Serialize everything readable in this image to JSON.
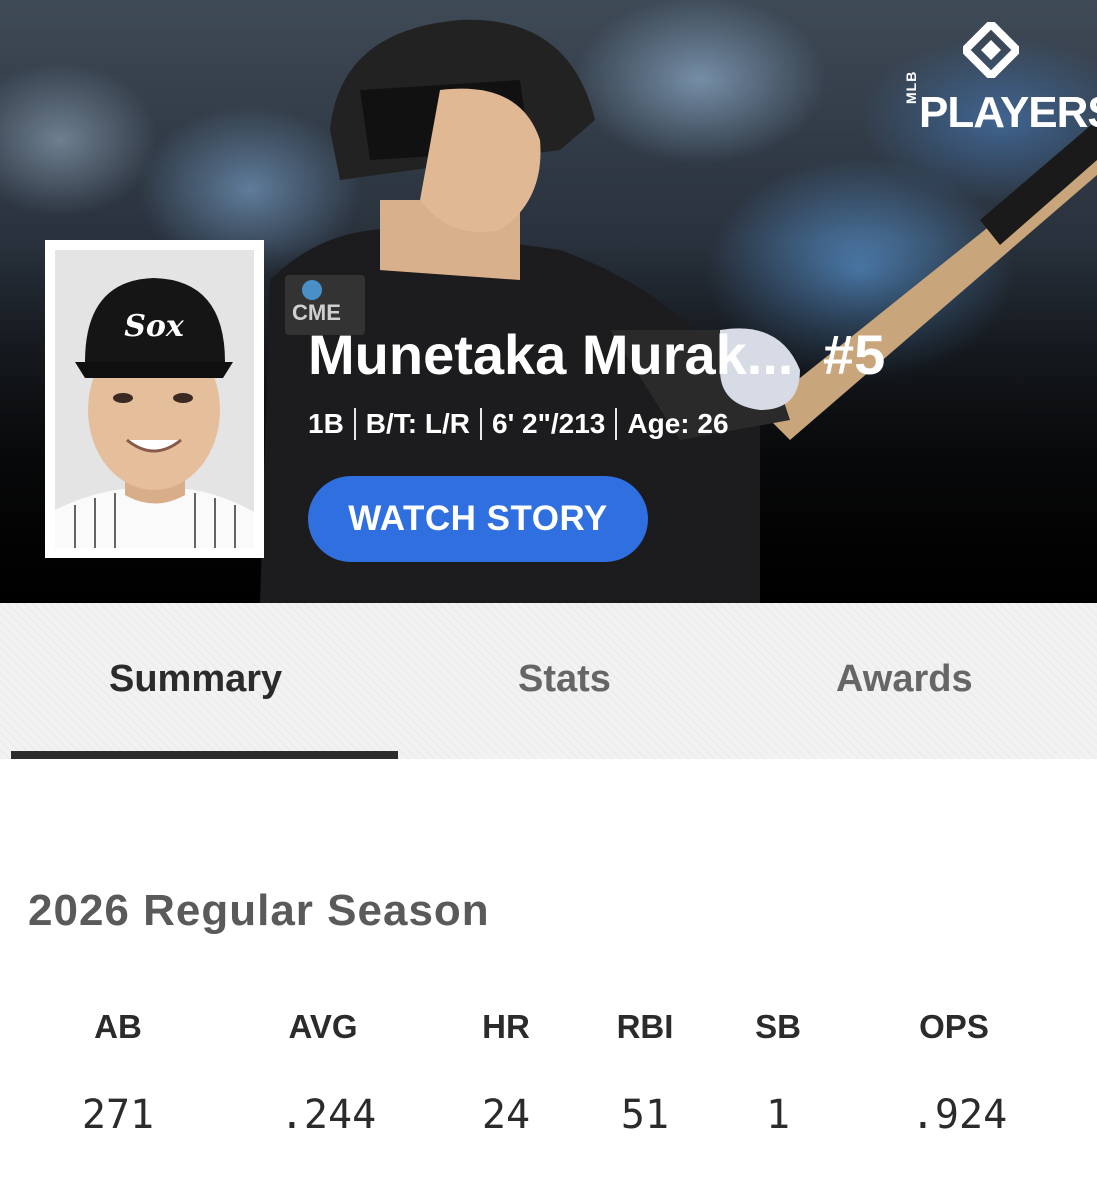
{
  "brand": {
    "logo_mlb": "MLB",
    "logo_players": "PLAYERS"
  },
  "player": {
    "name": "Munetaka Murak...",
    "number": "#5",
    "position": "1B",
    "bats_throws": "B/T: L/R",
    "height_weight": "6' 2\"/213",
    "age": "Age: 26",
    "cap_logo": "Sox"
  },
  "actions": {
    "watch_story": "WATCH STORY"
  },
  "tabs": [
    {
      "label": "Summary",
      "active": true
    },
    {
      "label": "Stats",
      "active": false
    },
    {
      "label": "Awards",
      "active": false
    }
  ],
  "season": {
    "title": "2026 Regular Season",
    "stats": [
      {
        "label": "AB",
        "value": "271"
      },
      {
        "label": "AVG",
        "value": ".244"
      },
      {
        "label": "HR",
        "value": "24"
      },
      {
        "label": "RBI",
        "value": "51"
      },
      {
        "label": "SB",
        "value": "1"
      },
      {
        "label": "OPS",
        "value": ".924"
      }
    ]
  },
  "colors": {
    "accent_button": "#2f6fe0",
    "tab_active": "#2b2b2b",
    "tab_inactive": "#666666",
    "season_title": "#5a5a5a"
  }
}
